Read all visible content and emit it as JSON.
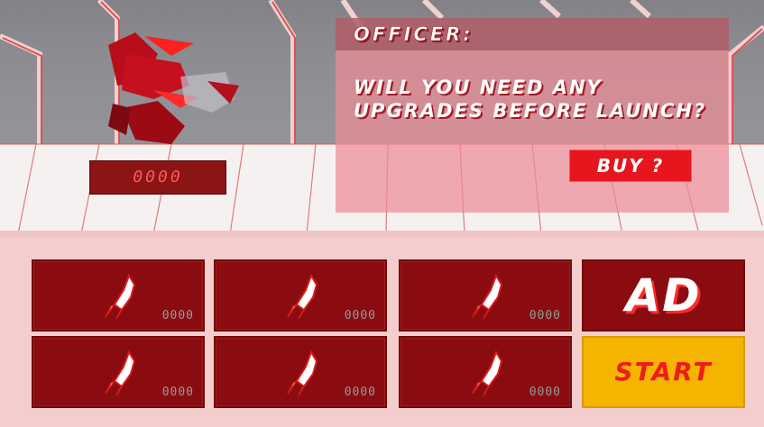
{
  "dialog": {
    "speaker": "OFFICER:",
    "message": "WILL YOU NEED ANY UPGRADES BEFORE LAUNCH?",
    "buy_label": "BUY ?"
  },
  "coins": "0000",
  "upgrades": [
    {
      "icon": "rocket-icon",
      "price": "0000"
    },
    {
      "icon": "rocket-icon",
      "price": "0000"
    },
    {
      "icon": "rocket-icon",
      "price": "0000"
    },
    {
      "icon": "rocket-icon",
      "price": "0000"
    },
    {
      "icon": "rocket-icon",
      "price": "0000"
    },
    {
      "icon": "rocket-icon",
      "price": "0000"
    }
  ],
  "ad_label": "AD",
  "start_label": "START",
  "colors": {
    "accent_red": "#e7151d",
    "slot_red": "#8a0c10",
    "start_yellow": "#f5b400",
    "panel_pink": "#f4cdcd"
  }
}
